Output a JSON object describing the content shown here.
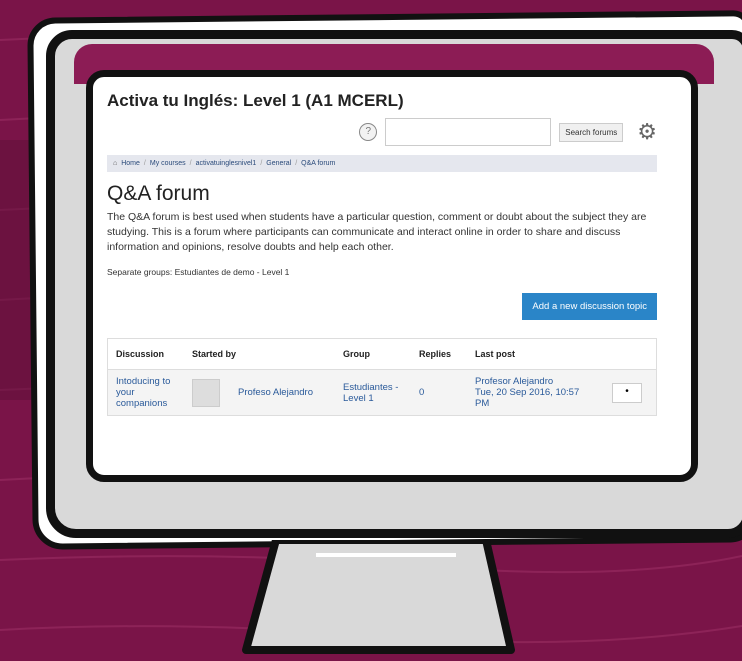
{
  "site": {
    "title": "Activa tu Inglés: Level 1 (A1 MCERL)"
  },
  "header": {
    "help_icon": "question-circle-icon",
    "help_glyph": "?",
    "search_placeholder": "",
    "search_button": "Search forums",
    "settings_icon": "gear-icon",
    "settings_glyph": "⚙"
  },
  "breadcrumb": {
    "home_glyph": "⌂",
    "items": [
      "Home",
      "My courses",
      "activatuinglesnivel1",
      "General",
      "Q&A forum"
    ],
    "separator": "/"
  },
  "main": {
    "heading": "Q&A forum",
    "intro": "The Q&A forum is best used when students have a particular question, comment or doubt about the subject they are studying. This is a forum where  participants can communicate and interact online in order to share and discuss information and opinions, resolve doubts and help each other.",
    "groups_text": "Separate groups: Estudiantes de demo - Level 1",
    "add_button": "Add a new discussion topic"
  },
  "table": {
    "columns": [
      "Discussion",
      "Started by",
      "Group",
      "Replies",
      "Last post"
    ],
    "rows": [
      {
        "discussion": "Intoducing to your companions",
        "started_by": "Profeso Alejandro",
        "group": "Estudiantes - Level 1",
        "replies": "0",
        "last_post_author": "Profesor Alejandro",
        "last_post_date": "Tue, 20 Sep 2016, 10:57 PM",
        "menu_glyph": "•"
      }
    ]
  },
  "colors": {
    "background": "#7a1448",
    "accent_button": "#2a85c8",
    "breadcrumb_bg": "#e5e7ee"
  }
}
